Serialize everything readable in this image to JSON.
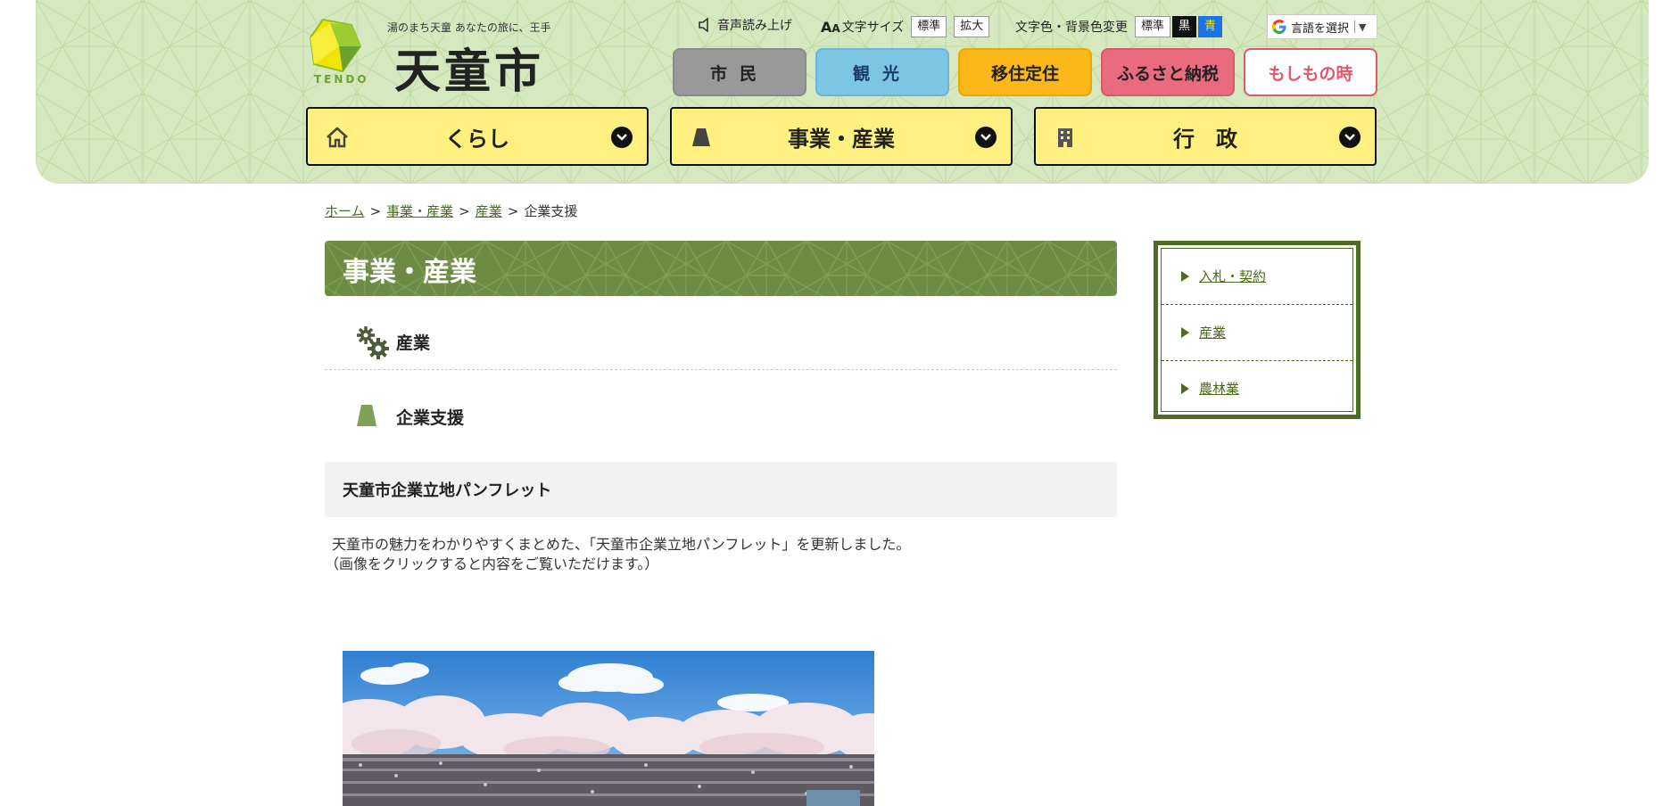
{
  "header": {
    "logo": {
      "tagline": "湯のまち天童 あなたの旅に、王手",
      "name": "天童市",
      "english": "TENDO"
    },
    "utilities": {
      "voice_label": "音声読み上げ",
      "font_size_label": "文字サイズ",
      "font_standard": "標準",
      "font_large": "拡大",
      "color_label": "文字色・背景色変更",
      "color_standard": "標準",
      "color_black": "黒",
      "color_blue": "青",
      "translate_label": "言語を選択"
    },
    "category_buttons": [
      {
        "label": "市民"
      },
      {
        "label": "観光"
      },
      {
        "label": "移住定住"
      },
      {
        "label": "ふるさと納税"
      },
      {
        "label": "もしもの時"
      }
    ],
    "main_nav": [
      {
        "label": "くらし"
      },
      {
        "label": "事業・産業"
      },
      {
        "label": "行　政"
      }
    ],
    "colors": {
      "header_bg": "#d6e8c0",
      "nav_yellow": "#fff07f",
      "title_green": "#6b8c42"
    }
  },
  "breadcrumb": [
    {
      "label": "ホーム"
    },
    {
      "label": "事業・産業"
    },
    {
      "label": "産業"
    },
    {
      "label": "企業支援"
    }
  ],
  "main": {
    "page_title": "事業・産業",
    "sub_category": "産業",
    "sub_page": "企業支援",
    "section_title": "天童市企業立地パンフレット",
    "body_line1": "天童市の魅力をわかりやすくまとめた、「天童市企業立地パンフレット」を更新しました。",
    "body_line2": "（画像をクリックすると内容をご覧いただけます。）"
  },
  "sidebar": {
    "items": [
      {
        "label": "入札・契約"
      },
      {
        "label": "産業"
      },
      {
        "label": "農林業"
      }
    ]
  }
}
